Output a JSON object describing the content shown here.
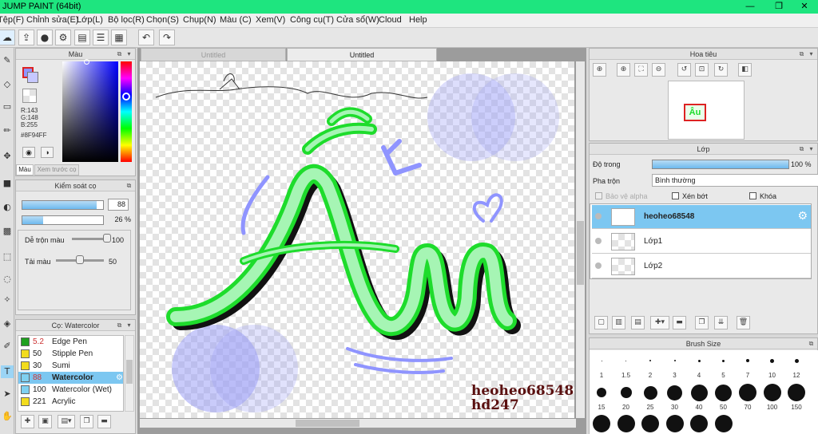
{
  "window": {
    "title": "JUMP PAINT (64bit)"
  },
  "menu": [
    "Tệp(F)",
    "Chỉnh sửa(E)",
    "Lớp(L)",
    "Bộ lọc(R)",
    "Chọn(S)",
    "Chụp(N)",
    "Màu (C)",
    "Xem(V)",
    "Công cụ(T)",
    "Cửa sổ(W)",
    "Cloud",
    "Help"
  ],
  "color_panel": {
    "title": "Màu",
    "r": "R:143",
    "g": "G:148",
    "b": "B:255",
    "hex": "#8F94FF",
    "tab_color": "Màu",
    "tab_preview": "Xem trước cọ",
    "fg_color": "#8f94ff"
  },
  "brush_control": {
    "title": "Kiểm soát cọ",
    "size_value": "88",
    "size_fill": 0.92,
    "opacity_value": "26 %",
    "opacity_fill": 0.26,
    "mix_label": "Dễ trộn màu",
    "mix_value": "100",
    "mix_level": 1.0,
    "reload_label": "Tải màu",
    "reload_value": "50",
    "reload_level": 0.5
  },
  "brush_list": {
    "title": "Cọ: Watercolor",
    "items": [
      {
        "num": "5.2",
        "label": "Edge Pen",
        "color": "#1fa01f"
      },
      {
        "num": "50",
        "label": "Stipple Pen",
        "color": "#f2dc1e"
      },
      {
        "num": "30",
        "label": "Sumi",
        "color": "#f2dc1e"
      },
      {
        "num": "88",
        "label": "Watercolor",
        "color": "#7fd0f0"
      },
      {
        "num": "100",
        "label": "Watercolor (Wet)",
        "color": "#7fd0f0"
      },
      {
        "num": "221",
        "label": "Acrylic",
        "color": "#f2dc1e"
      }
    ]
  },
  "canvas": {
    "tabs": [
      "Untitled",
      "Untitled"
    ],
    "signature_line1": "heoheo68548",
    "signature_line2": "hd247"
  },
  "navigator": {
    "title": "Hoa tiêu"
  },
  "layers": {
    "title": "Lớp",
    "opacity_label": "Độ trong",
    "opacity_value": "100 %",
    "opacity_fill": 1.0,
    "blend_label": "Pha trộn",
    "blend_value": "Bình thường",
    "protect_alpha": "Bảo vệ alpha",
    "clipping": "Xén bớt",
    "lock": "Khóa",
    "items": [
      {
        "name": "heoheo68548",
        "selected": true
      },
      {
        "name": "Lớp1",
        "selected": false
      },
      {
        "name": "Lớp2",
        "selected": false
      }
    ]
  },
  "brush_size": {
    "title": "Brush Size",
    "row1_labels": [
      "1",
      "1.5",
      "2",
      "3",
      "4",
      "5",
      "7",
      "10",
      "12"
    ],
    "row2_labels": [
      "15",
      "20",
      "25",
      "30",
      "40",
      "50",
      "70",
      "100",
      "150"
    ]
  },
  "colors": {
    "accent_green": "#1ee57f",
    "selected_layer": "#7cc7f1",
    "lettering_fill": "#a6f5b4",
    "lettering_outline": "#1edc2c",
    "circle_blue": "#9da0f6"
  }
}
